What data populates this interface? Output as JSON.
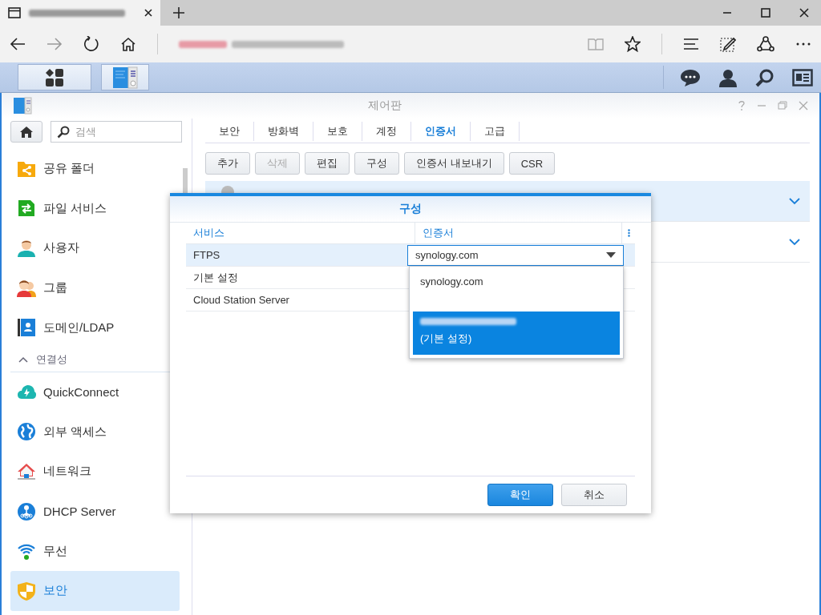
{
  "window": {
    "title": "제어판"
  },
  "sidebar": {
    "search": {
      "placeholder": "검색"
    },
    "groups": [
      {
        "items": [
          {
            "label": "공유 폴더",
            "selected": false
          },
          {
            "label": "파일 서비스",
            "selected": false
          },
          {
            "label": "사용자",
            "selected": false
          },
          {
            "label": "그룹",
            "selected": false
          },
          {
            "label": "도메인/LDAP",
            "selected": false
          }
        ]
      },
      {
        "header": "연결성",
        "expanded": true,
        "items": [
          {
            "label": "QuickConnect",
            "selected": false
          },
          {
            "label": "외부 액세스",
            "selected": false
          },
          {
            "label": "네트워크",
            "selected": false
          },
          {
            "label": "DHCP Server",
            "selected": false
          },
          {
            "label": "무선",
            "selected": false
          },
          {
            "label": "보안",
            "selected": true
          }
        ]
      }
    ]
  },
  "tabs": [
    {
      "label": "보안",
      "selected": false
    },
    {
      "label": "방화벽",
      "selected": false
    },
    {
      "label": "보호",
      "selected": false
    },
    {
      "label": "계정",
      "selected": false
    },
    {
      "label": "인증서",
      "selected": true
    },
    {
      "label": "고급",
      "selected": false
    }
  ],
  "toolbar": [
    {
      "label": "추가",
      "disabled": false
    },
    {
      "label": "삭제",
      "disabled": true
    },
    {
      "label": "편집",
      "disabled": false
    },
    {
      "label": "구성",
      "disabled": false
    },
    {
      "label": "인증서 내보내기",
      "disabled": false
    },
    {
      "label": "CSR",
      "disabled": false
    }
  ],
  "certificate_rows": [
    {
      "selected": true
    },
    {
      "selected": false
    }
  ],
  "dialog": {
    "title": "구성",
    "columns": [
      "서비스",
      "인증서"
    ],
    "rows": [
      {
        "service": "FTPS",
        "certificate": "synology.com",
        "selected": true
      },
      {
        "service": "기본 설정",
        "selected": false
      },
      {
        "service": "Cloud Station Server",
        "selected": false
      }
    ],
    "dropdown": {
      "options": [
        {
          "lines": [
            "synology.com"
          ],
          "redacted": false,
          "selected": false
        },
        {
          "lines": [
            "(기본 설정)"
          ],
          "redacted": true,
          "selected": true
        }
      ]
    },
    "buttons": [
      {
        "label": "확인",
        "kind": "primary"
      },
      {
        "label": "취소",
        "kind": "default"
      }
    ]
  }
}
